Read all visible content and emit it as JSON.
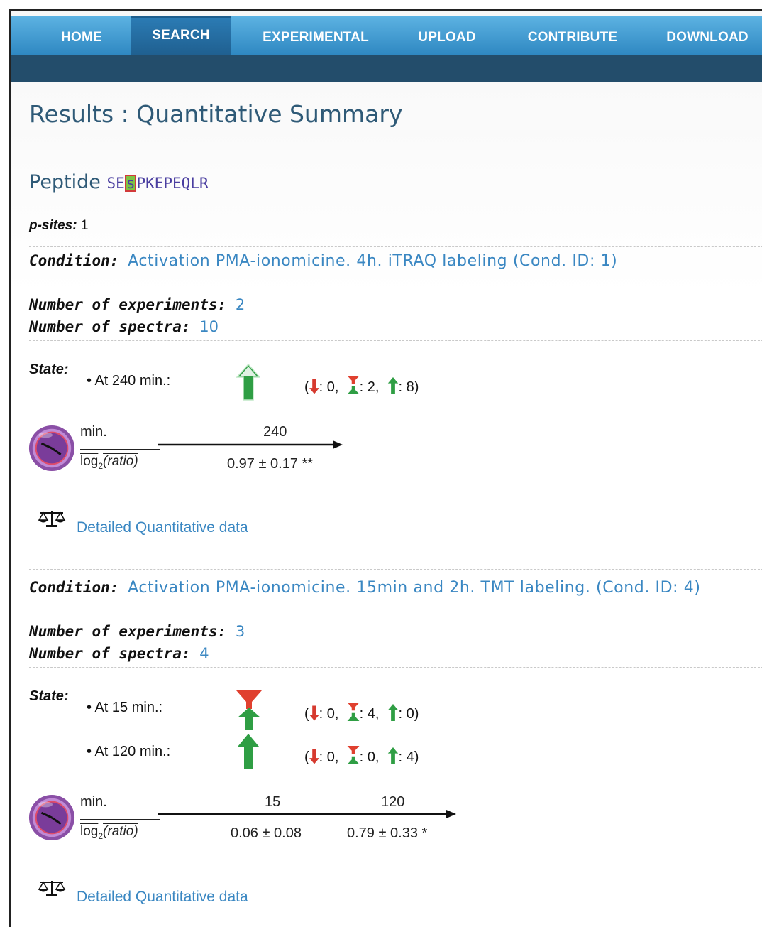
{
  "nav": {
    "items": [
      "HOME",
      "SEARCH",
      "EXPERIMENTAL",
      "UPLOAD",
      "CONTRIBUTE",
      "DOWNLOAD"
    ],
    "active": "SEARCH"
  },
  "page_title": "Results : Quantitative Summary",
  "peptide": {
    "label": "Peptide",
    "seq_before": "SE",
    "site": "s",
    "seq_after": "PKEPEQLR"
  },
  "psites": {
    "label": "p-sites:",
    "value": "1"
  },
  "conditions": [
    {
      "label": "Condition:",
      "text": "Activation PMA-ionomicine. 4h. iTRAQ labeling (Cond. ID: 1)",
      "experiments_label": "Number of experiments:",
      "experiments": "2",
      "spectra_label": "Number of spectra:",
      "spectra": "10",
      "state_label": "State:",
      "states": [
        {
          "label": "At 240 min.:",
          "status": "up",
          "down": "0",
          "unchanged": "2",
          "up": "8"
        }
      ],
      "timeline": {
        "min_label": "min.",
        "ratio_label_log": "log",
        "ratio_label_sub": "2",
        "ratio_label_rest": "(ratio)",
        "times": [
          "240"
        ],
        "values": [
          "0.97 ± 0.17 **"
        ]
      },
      "link": "Detailed Quantitative data"
    },
    {
      "label": "Condition:",
      "text": "Activation PMA-ionomicine. 15min and 2h. TMT labeling. (Cond. ID: 4)",
      "experiments_label": "Number of experiments:",
      "experiments": "3",
      "spectra_label": "Number of spectra:",
      "spectra": "4",
      "state_label": "State:",
      "states": [
        {
          "label": "At 15 min.:",
          "status": "unchanged",
          "down": "0",
          "unchanged": "4",
          "up": "0"
        },
        {
          "label": "At 120 min.:",
          "status": "up",
          "down": "0",
          "unchanged": "0",
          "up": "4"
        }
      ],
      "timeline": {
        "min_label": "min.",
        "ratio_label_log": "log",
        "ratio_label_sub": "2",
        "ratio_label_rest": "(ratio)",
        "times": [
          "15",
          "120"
        ],
        "values": [
          "0.06 ± 0.08",
          "0.79 ± 0.33 *"
        ]
      },
      "link": "Detailed Quantitative data"
    }
  ],
  "icons": {
    "up": "green-up-arrow-icon",
    "down": "red-down-arrow-icon",
    "unchanged": "red-green-bowtie-icon",
    "clock": "purple-clock-icon",
    "scale": "balance-scale-icon"
  },
  "colors": {
    "nav_top": "#5cb2e2",
    "nav_bottom": "#234d6b",
    "link": "#3a87c2",
    "up": "#2f9e44",
    "down": "#d63a2f"
  }
}
